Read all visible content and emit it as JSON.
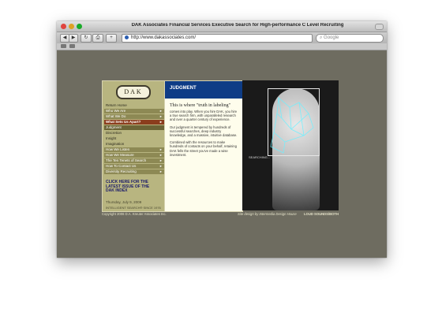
{
  "window": {
    "title": "DAK Associates Financial Services Executive Search for High-performance C Level Recruiting"
  },
  "toolbar": {
    "back_label": "◀",
    "forward_label": "▶",
    "url": "http://www.dakassociates.com/",
    "search_placeholder": "Google"
  },
  "site": {
    "logo": "DAK",
    "return_home": "Return Home",
    "nav": [
      {
        "label": "Who We Are",
        "style": "boxed"
      },
      {
        "label": "What We Do",
        "style": "boxed"
      },
      {
        "label": "What Sets Us Apart?",
        "style": "active"
      },
      {
        "label": "Judgment",
        "style": "sub"
      },
      {
        "label": "Discretion",
        "style": "plain"
      },
      {
        "label": "Insight",
        "style": "plain"
      },
      {
        "label": "Imagination",
        "style": "plain"
      },
      {
        "label": "How We Listen",
        "style": "boxed"
      },
      {
        "label": "How We Measure",
        "style": "boxed"
      },
      {
        "label": "The Ten Tenets of Search",
        "style": "boxed"
      },
      {
        "label": "How To Contact Us",
        "style": "boxed"
      },
      {
        "label": "Diversity Recruiting",
        "style": "boxed"
      }
    ],
    "cta": "CLICK HERE FOR THE LATEST ISSUE OF THE DAK INDEX",
    "date": "Thursday, July 9, 2009",
    "tagline": "INTELLIGENT SEARCH® SINCE 1976",
    "section_title": "JUDGMENT",
    "mid_title": "This is where \"truth in labeling\"",
    "paragraphs": [
      "comes into play. When you hire DAK, you hire a true search firm, with unparalleled research and over a quarter century of experience.",
      "Our judgment is tempered by hundreds of successful searches, deep industry knowledge, and a massive, intuitive database.",
      "Combined with the resources to make hundreds of contacts on your behalf, retaining DAK fells the street you've made a wise investment."
    ],
    "scan_label": "SEARCHING...",
    "footer_copyright": "Copyright 2006 D.A. Kreuter Associates Inc.",
    "footer_credit": "Site design by Intermedia Design House",
    "footer_loud": "LOUD SOUNDS/BOTH"
  }
}
